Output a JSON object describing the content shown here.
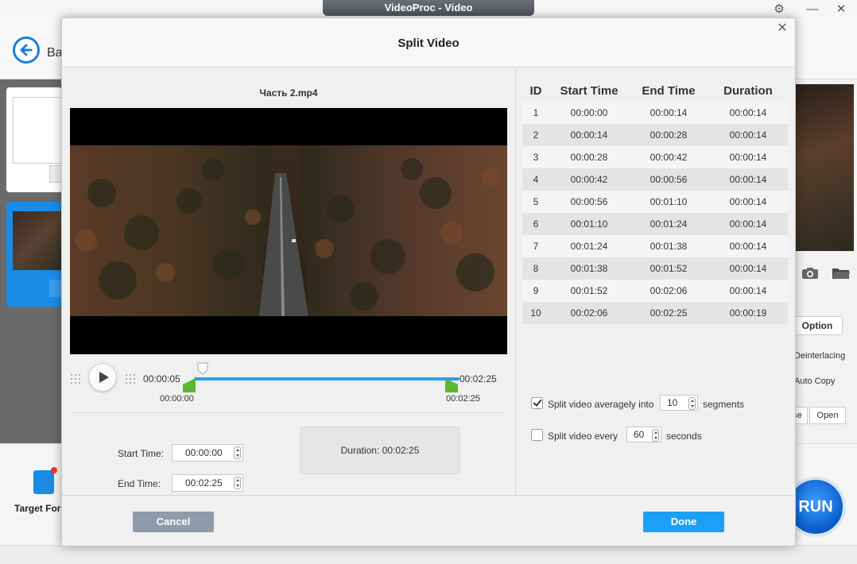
{
  "app": {
    "title": "VideoProc - Video",
    "back_label": "Ba",
    "target_format_label": "Target For",
    "option_label": "Option",
    "deinterlacing_label": "Deinterlacing",
    "auto_copy_label": "Auto Copy",
    "browse_label": "se",
    "open_label": "Open",
    "run_label": "RUN",
    "icons": {
      "gear": "gear-icon",
      "minimize": "minimize-icon",
      "close": "close-icon",
      "back": "arrow-left-icon",
      "camera": "camera-icon",
      "folder": "folder-icon"
    }
  },
  "dialog": {
    "title": "Split Video",
    "close_icon": "close-icon",
    "file_name": "Часть 2.mp4",
    "player": {
      "current_time": "00:00:05",
      "total_time": "00:02:25",
      "range_start": "00:00:00",
      "range_end": "00:02:25",
      "playhead_fraction": 0.034
    },
    "start_time_label": "Start Time:",
    "start_time_value": "00:00:00",
    "end_time_label": "End Time:",
    "end_time_value": "00:02:25",
    "duration_text": "Duration:  00:02:25",
    "table": {
      "headers": [
        "ID",
        "Start Time",
        "End Time",
        "Duration"
      ],
      "rows": [
        [
          "1",
          "00:00:00",
          "00:00:14",
          "00:00:14"
        ],
        [
          "2",
          "00:00:14",
          "00:00:28",
          "00:00:14"
        ],
        [
          "3",
          "00:00:28",
          "00:00:42",
          "00:00:14"
        ],
        [
          "4",
          "00:00:42",
          "00:00:56",
          "00:00:14"
        ],
        [
          "5",
          "00:00:56",
          "00:01:10",
          "00:00:14"
        ],
        [
          "6",
          "00:01:10",
          "00:01:24",
          "00:00:14"
        ],
        [
          "7",
          "00:01:24",
          "00:01:38",
          "00:00:14"
        ],
        [
          "8",
          "00:01:38",
          "00:01:52",
          "00:00:14"
        ],
        [
          "9",
          "00:01:52",
          "00:02:06",
          "00:00:14"
        ],
        [
          "10",
          "00:02:06",
          "00:02:25",
          "00:00:19"
        ]
      ]
    },
    "options": {
      "split_average": {
        "checked": true,
        "label": "Split video averagely into",
        "value": "10",
        "unit": "segments"
      },
      "split_every": {
        "checked": false,
        "label": "Split video every",
        "value": "60",
        "unit": "seconds"
      }
    },
    "buttons": {
      "cancel": "Cancel",
      "done": "Done"
    },
    "colors": {
      "accent": "#1aa0f5",
      "timeline": "#2aa0ee",
      "range_marker": "#5bb832",
      "cancel": "#8f9aab"
    }
  }
}
